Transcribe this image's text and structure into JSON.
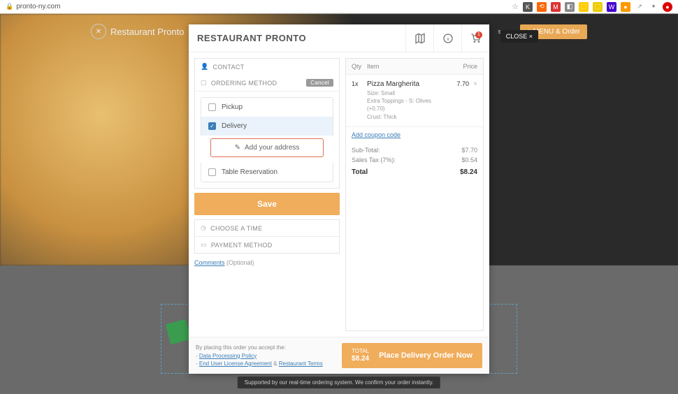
{
  "browser": {
    "url": "pronto-ny.com"
  },
  "nav": {
    "brand": "Restaurant Pronto",
    "reserv": "serva",
    "menu_btn": "e MENU & Order"
  },
  "close_btn": "CLOSE ×",
  "modal": {
    "title": "RESTAURANT PRONTO",
    "cart_count": "1"
  },
  "sections": {
    "contact": "CONTACT",
    "ordering": "ORDERING METHOD",
    "cancel": "Cancel",
    "choose_time": "CHOOSE A TIME",
    "payment": "PAYMENT METHOD"
  },
  "methods": {
    "pickup": "Pickup",
    "delivery": "Delivery",
    "table": "Table Reservation",
    "add_address": "Add your address"
  },
  "save_label": "Save",
  "comments": {
    "link": "Comments",
    "optional": "(Optional)"
  },
  "cart": {
    "header_qty": "Qty",
    "header_item": "Item",
    "header_price": "Price",
    "items": [
      {
        "qty": "1x",
        "name": "Pizza Margherita",
        "size": "Size: Small",
        "extras": "Extra Toppings - S: Olives (+0.70)",
        "crust": "Crust: Thick",
        "price": "7.70"
      }
    ],
    "coupon": "Add coupon code",
    "subtotal_label": "Sub-Total:",
    "subtotal": "$7.70",
    "tax_label": "Sales Tax (7%):",
    "tax": "$0.54",
    "total_label": "Total",
    "total": "$8.24"
  },
  "footer": {
    "legal_intro": "By placing this order you accept the:",
    "dpp": "Data Processing Policy",
    "eula": "End User License Agreement",
    "amp": " & ",
    "terms": "Restaurant Terms",
    "total_label": "TOTAL",
    "total_value": "$8.24",
    "place_btn": "Place Delivery Order Now"
  },
  "banner": "Supported by our real-time ordering system. We confirm your order instantly."
}
